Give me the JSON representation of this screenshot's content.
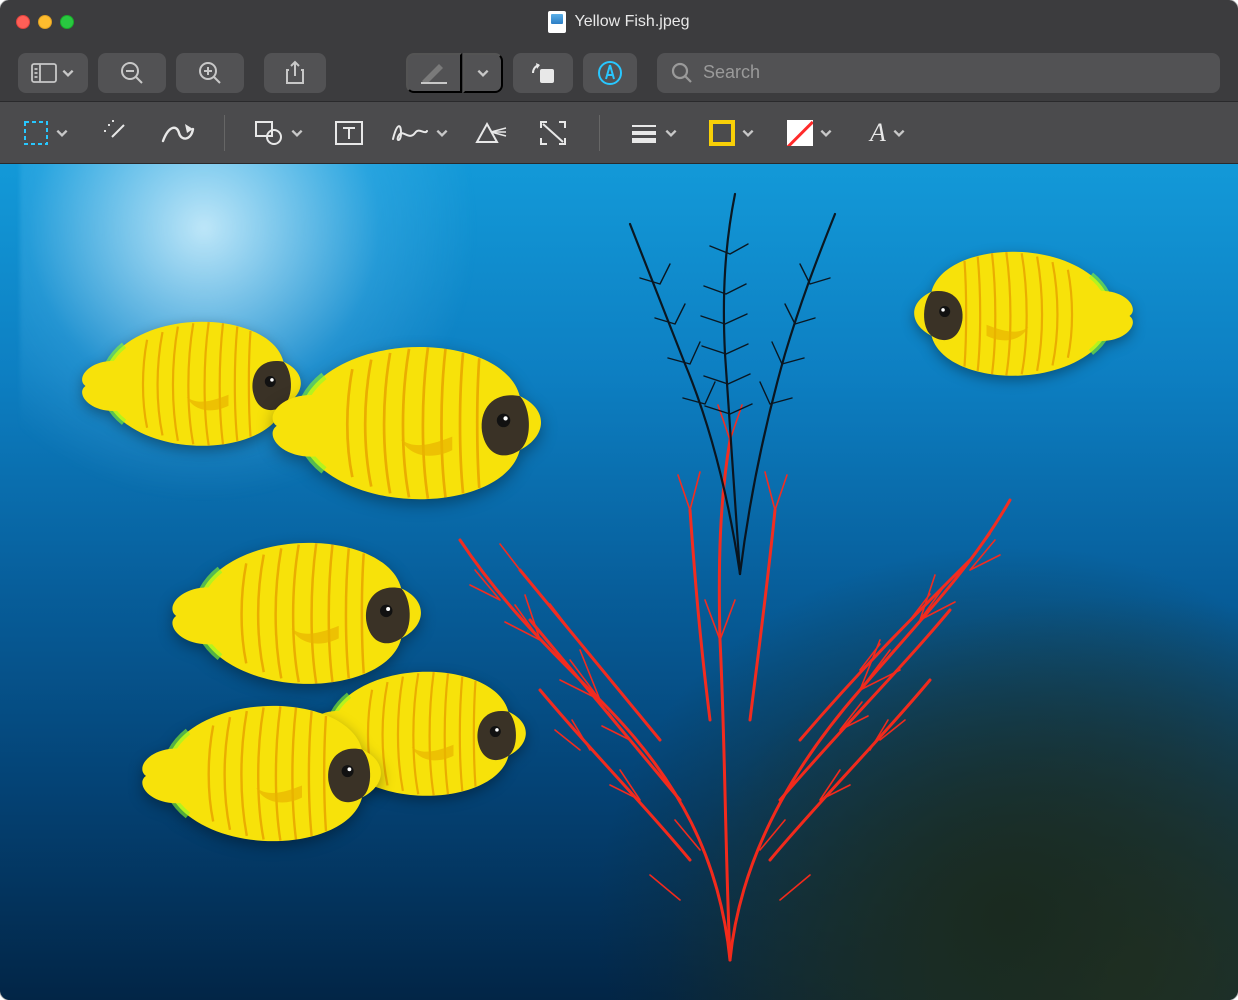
{
  "window": {
    "title": "Yellow Fish.jpeg",
    "file_icon": "image-file-icon"
  },
  "toolbar": {
    "sidebar": "sidebar-toggle",
    "zoom_out": "zoom-out",
    "zoom_in": "zoom-in",
    "share": "share",
    "markup": "markup-pencil",
    "markup_dropdown": "markup-dropdown",
    "rotate": "rotate-left",
    "highlight": "highlight-markup-toggle"
  },
  "search": {
    "placeholder": "Search",
    "value": ""
  },
  "markup_tools": {
    "selection": "rectangular-selection",
    "instant_alpha": "instant-alpha",
    "sketch": "sketch",
    "shapes": "shapes",
    "text": "text",
    "sign": "sign",
    "adjust_color": "adjust-color",
    "adjust_size": "adjust-size",
    "line_style": "line-style",
    "border_color": "border-color",
    "fill_color": "fill-color",
    "font_style": "font-style"
  },
  "colors": {
    "border_swatch": "#f8d007",
    "fill_swatch": "#ffffff",
    "highlight_ring": "#28c7ff"
  },
  "image": {
    "description": "Underwater coral reef scene with yellow masked butterflyfish and red sea fan coral",
    "fish_count": 6,
    "subject": "Yellow Fish"
  }
}
